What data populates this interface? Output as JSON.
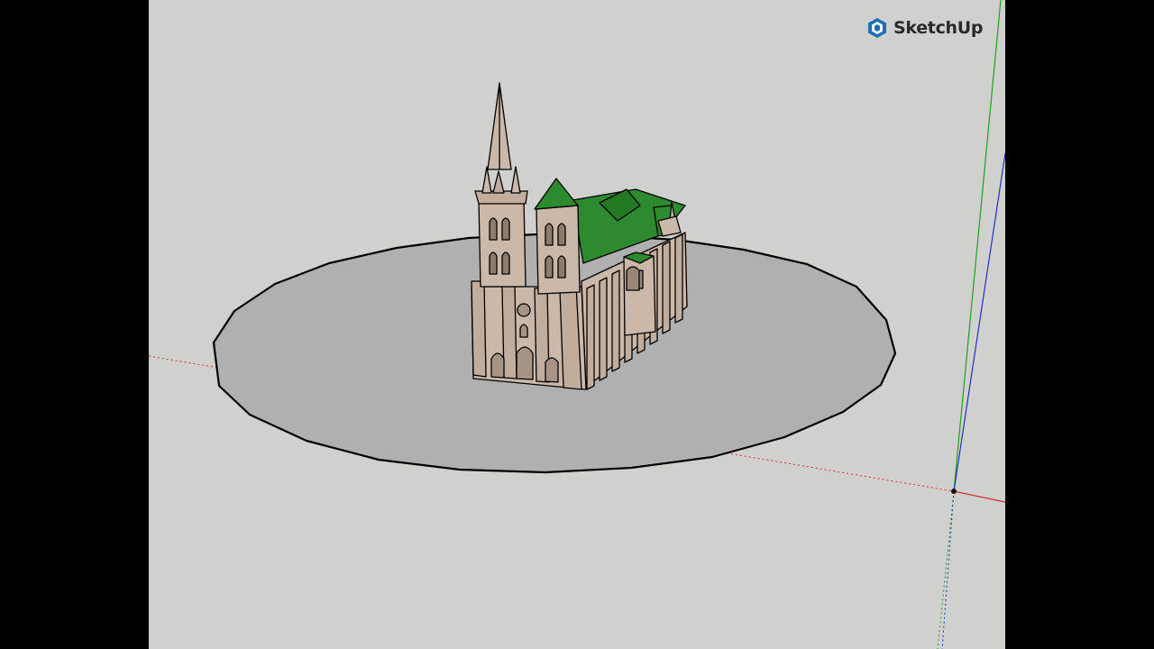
{
  "app": {
    "logo_text": "SketchUp",
    "logo_icon": "sketchup-logo-icon"
  },
  "viewport": {
    "background": "#d0d0ce",
    "letterbox": "#000000"
  },
  "model": {
    "name": "cathedral",
    "ground_disc_color": "#b0b0b0",
    "wall_color": "#cbb8a8",
    "roof_color": "#2e8a2e",
    "edge_color": "#000000"
  },
  "axes": {
    "red": "#d03030",
    "green": "#20a020",
    "blue": "#2030c0"
  }
}
